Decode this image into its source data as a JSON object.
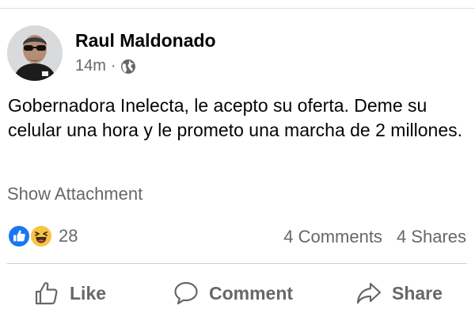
{
  "post": {
    "author": "Raul Maldonado",
    "time": "14m",
    "separator": "·",
    "privacy_icon": "globe-icon",
    "text": "Gobernadora Inelecta, le acepto su oferta. Deme su celular una hora y le prometo una marcha de 2 millones.",
    "attachment_label": "Show Attachment"
  },
  "stats": {
    "reaction_icons": [
      "like-reaction-icon",
      "haha-reaction-icon"
    ],
    "reaction_count": "28",
    "comments": "4 Comments",
    "shares": "4 Shares"
  },
  "actions": {
    "like": "Like",
    "comment": "Comment",
    "share": "Share"
  },
  "colors": {
    "text_primary": "#050505",
    "text_secondary": "#65676b",
    "like_blue": "#1877f2",
    "haha_yellow": "#f7c442",
    "divider": "#ced0d4"
  }
}
